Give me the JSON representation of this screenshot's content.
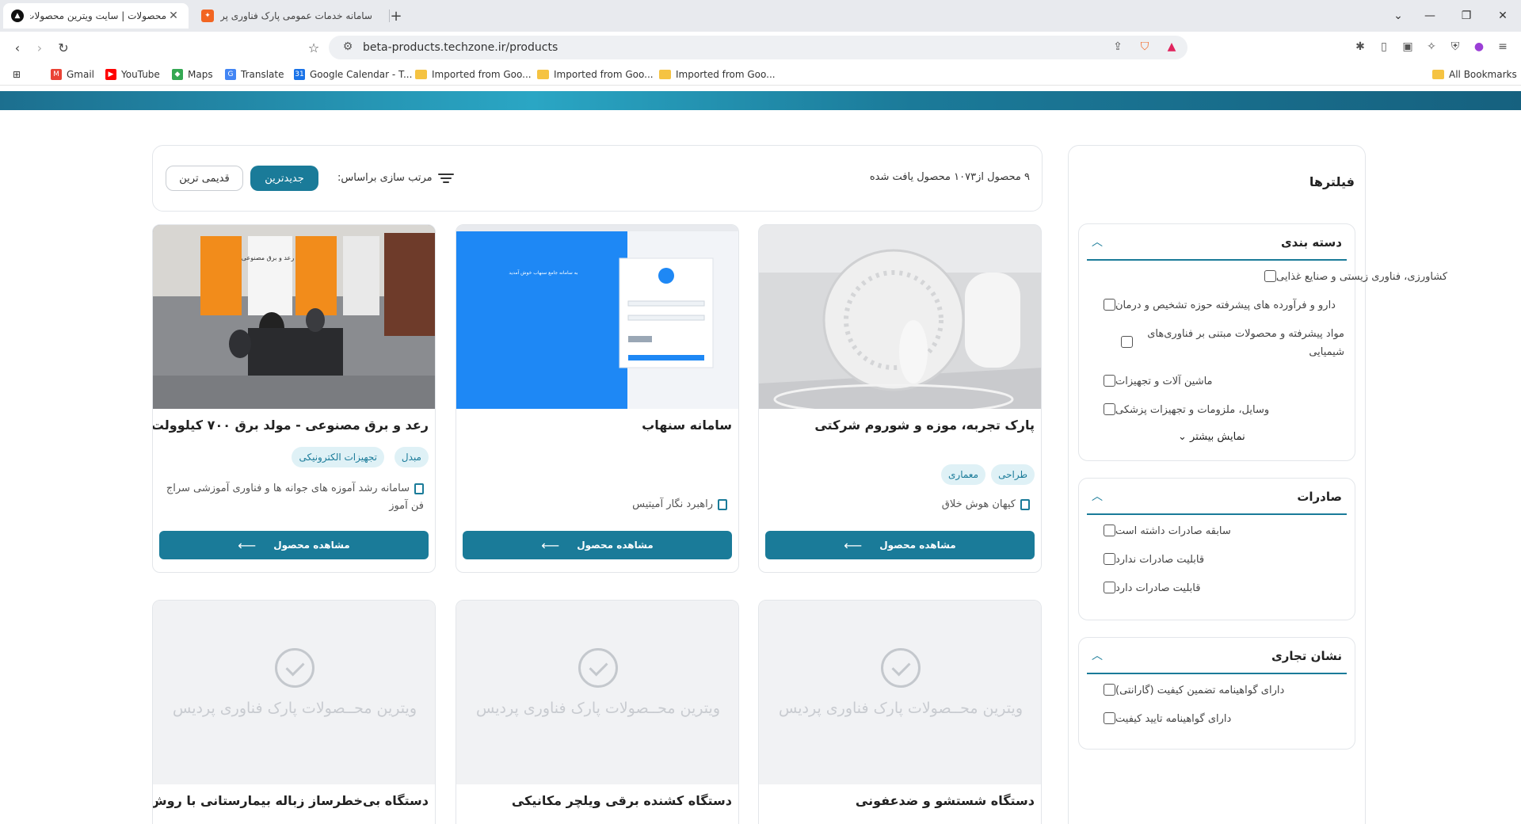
{
  "browser": {
    "tabs": [
      {
        "title": "محصولات | سایت ویترین محصولات",
        "active": true
      },
      {
        "title": "سامانه خدمات عمومی پارک فناوری پر",
        "active": false
      }
    ],
    "url": "beta-products.techzone.ir/products",
    "bookmarks": [
      {
        "label": "Gmail",
        "icon": "gmail-icon"
      },
      {
        "label": "YouTube",
        "icon": "youtube-icon"
      },
      {
        "label": "Maps",
        "icon": "maps-icon"
      },
      {
        "label": "Translate",
        "icon": "translate-icon"
      },
      {
        "label": "Google Calendar - T...",
        "icon": "calendar-icon"
      },
      {
        "label": "Imported from Goo...",
        "icon": "folder-icon"
      },
      {
        "label": "Imported from Goo...",
        "icon": "folder-icon"
      },
      {
        "label": "Imported from Goo...",
        "icon": "folder-icon"
      }
    ],
    "all_bookmarks": "All Bookmarks"
  },
  "colors": {
    "primary": "#1a7b99",
    "tag_bg": "#dff1f6",
    "placeholder_bg": "#f1f2f4"
  },
  "sort": {
    "result_count": "۹ محصول از۱۰۷۳ محصول یافت شده",
    "label": "مرتب سازی براساس:",
    "newest": "جدیدترین",
    "oldest": "قدیمی ترین"
  },
  "products": [
    {
      "title": "پارک تجربه، موزه و شوروم شرکتی",
      "tags": [
        "طراحی",
        "معماری"
      ],
      "company": "کیهان هوش خلاق",
      "button": "مشاهده محصول",
      "image": "museum-photo"
    },
    {
      "title": "سامانه سنهاب",
      "tags": [],
      "company": "راهبرد نگار آمیتیس",
      "button": "مشاهده محصول",
      "image": "login-screenshot",
      "image_text": "به سامانه جامع سنهاب خوش آمدید"
    },
    {
      "title": "رعد و برق مصنوعی - مولد برق ۷۰۰ کیلوولت",
      "tags": [
        "مبدل",
        "تجهیزات الکترونیکی"
      ],
      "company": "سامانه رشد آموزه های جوانه ها و فناوری آموزشی سراج فن آموز",
      "button": "مشاهده محصول",
      "image": "exhibition-photo",
      "image_text": "رعد و برق مصنوعی"
    },
    {
      "title": "دستگاه شستشو و ضدعفونی",
      "placeholder": "ویترین محــصولات پارک فناوری پردیس"
    },
    {
      "title": "دستگاه کشنده برقی ویلچر مکانیکی",
      "placeholder": "ویترین محــصولات پارک فناوری پردیس"
    },
    {
      "title": "دستگاه بی‌خطرساز زباله بیمارستانی با روش حرارت",
      "placeholder": "ویترین محــصولات پارک فناوری پردیس"
    }
  ],
  "filters": {
    "title": "فیلترها",
    "groups": [
      {
        "label": "دسته بندی",
        "options": [
          "کشاورزی، فناوری زیستی و صنایع غذایی",
          "دارو و فرآورده های پیشرفته حوزه تشخیص و درمان",
          "مواد پیشرفته و محصولات مبتنی بر فناوری‌های شیمیایی",
          "ماشین آلات و تجهیزات",
          "وسایل، ملزومات و تجهیزات پزشکی"
        ],
        "show_more": "نمایش بیشتر"
      },
      {
        "label": "صادرات",
        "options": [
          "سابقه صادرات داشته است",
          "قابلیت صادرات ندارد",
          "قابلیت صادرات دارد"
        ]
      },
      {
        "label": "نشان تجاری",
        "options": [
          "دارای گواهینامه تضمین کیفیت (گارانتی)",
          "دارای گواهینامه تایید کیفیت"
        ]
      }
    ]
  }
}
